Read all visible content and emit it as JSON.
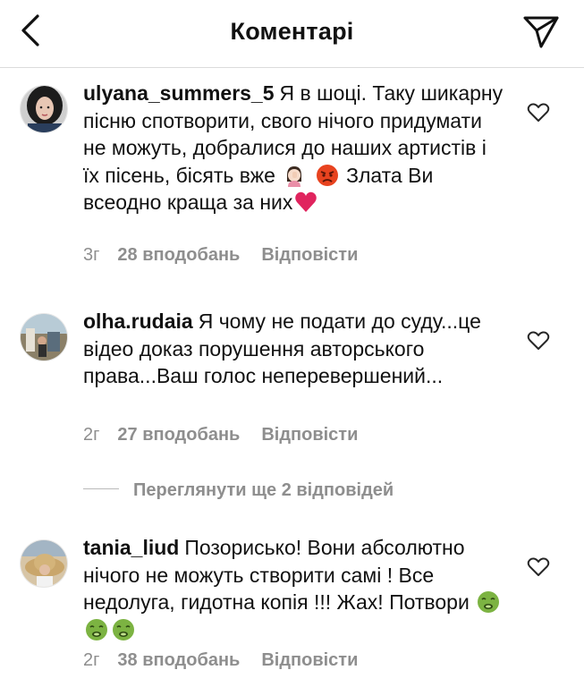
{
  "header": {
    "title": "Коментарі",
    "back_icon": "chevron-left-icon",
    "share_icon": "paper-plane-icon"
  },
  "comments": [
    {
      "username": "ulyana_summers_5",
      "text_before": "Я в шоці. Таку шикарну пісню спотворити, свого нічого придумати не можуть, добралися до наших артистів і їх пісень, бісять вже",
      "emoji_1": "woman-facepalming-emoji",
      "emoji_2": "angry-face-emoji",
      "text_middle": "Злата Ви всеодно краща за них",
      "emoji_3": "red-heart-emoji",
      "time": "3г",
      "likes": "28 вподобань",
      "reply": "Відповісти"
    },
    {
      "username": "olha.rudaia",
      "text": "Я чому не подати до суду...це відео доказ порушення авторського права...Ваш голос неперевершений...",
      "time": "2г",
      "likes": "27 вподобань",
      "reply": "Відповісти"
    },
    {
      "username": "tania_liud",
      "text": "Позорисько! Вони абсолютно нічого не можуть створити самі ! Все недолуга, гидотна копія !!! Жах! Потвори",
      "emoji": "nauseated-face-emoji",
      "time": "2г",
      "likes": "38 вподобань",
      "reply": "Відповісти"
    }
  ],
  "view_replies": "Переглянути ще 2 відповідей",
  "colors": {
    "text": "#111111",
    "secondary": "#8e8e8e",
    "divider": "#dbdbdb",
    "heart_red": "#e0245e",
    "angry_red": "#e8431f",
    "nausea_green": "#7cb342"
  }
}
